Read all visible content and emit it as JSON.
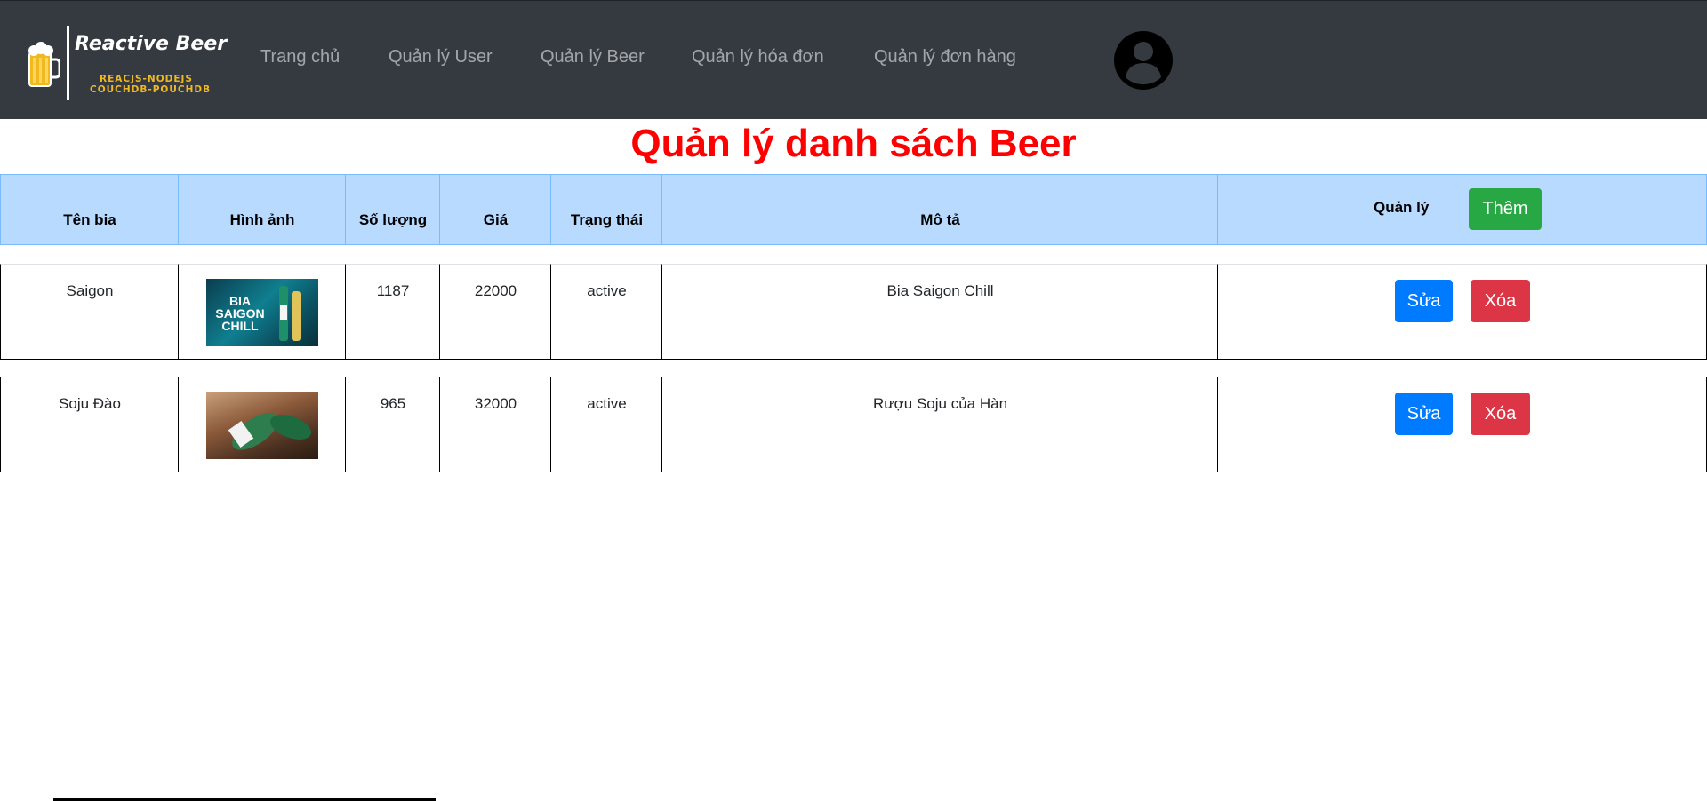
{
  "app": {
    "logo_title": "Reactive Beer",
    "logo_sub1": "REACJS-NODEJS",
    "logo_sub2": "COUCHDB-POUCHDB"
  },
  "nav": {
    "items": [
      {
        "label": "Trang chủ"
      },
      {
        "label": "Quản lý User"
      },
      {
        "label": "Quản lý Beer"
      },
      {
        "label": "Quản lý hóa đơn"
      },
      {
        "label": "Quản lý đơn hàng"
      }
    ],
    "avatar_icon": "user-circle-icon"
  },
  "page": {
    "title": "Quản lý danh sách Beer"
  },
  "table": {
    "headers": {
      "name": "Tên bia",
      "image": "Hình ảnh",
      "quantity": "Số lượng",
      "price": "Giá",
      "status": "Trạng thái",
      "description": "Mô tả",
      "manage": "Quản lý"
    },
    "add_button": "Thêm",
    "rows": [
      {
        "name": "Saigon",
        "image_text": "BIA SAIGON CHILL",
        "quantity": "1187",
        "price": "22000",
        "status": "active",
        "description": "Bia Saigon Chill",
        "edit_label": "Sửa",
        "delete_label": "Xóa"
      },
      {
        "name": "Soju Đào",
        "image_text": "",
        "quantity": "965",
        "price": "32000",
        "status": "active",
        "description": "Rượu Soju của Hàn",
        "edit_label": "Sửa",
        "delete_label": "Xóa"
      }
    ]
  },
  "colors": {
    "navbar_bg": "#343a40",
    "title": "#ff0000",
    "header_bg": "#b8daff",
    "add": "#28a745",
    "edit": "#007bff",
    "delete": "#dc3545"
  }
}
